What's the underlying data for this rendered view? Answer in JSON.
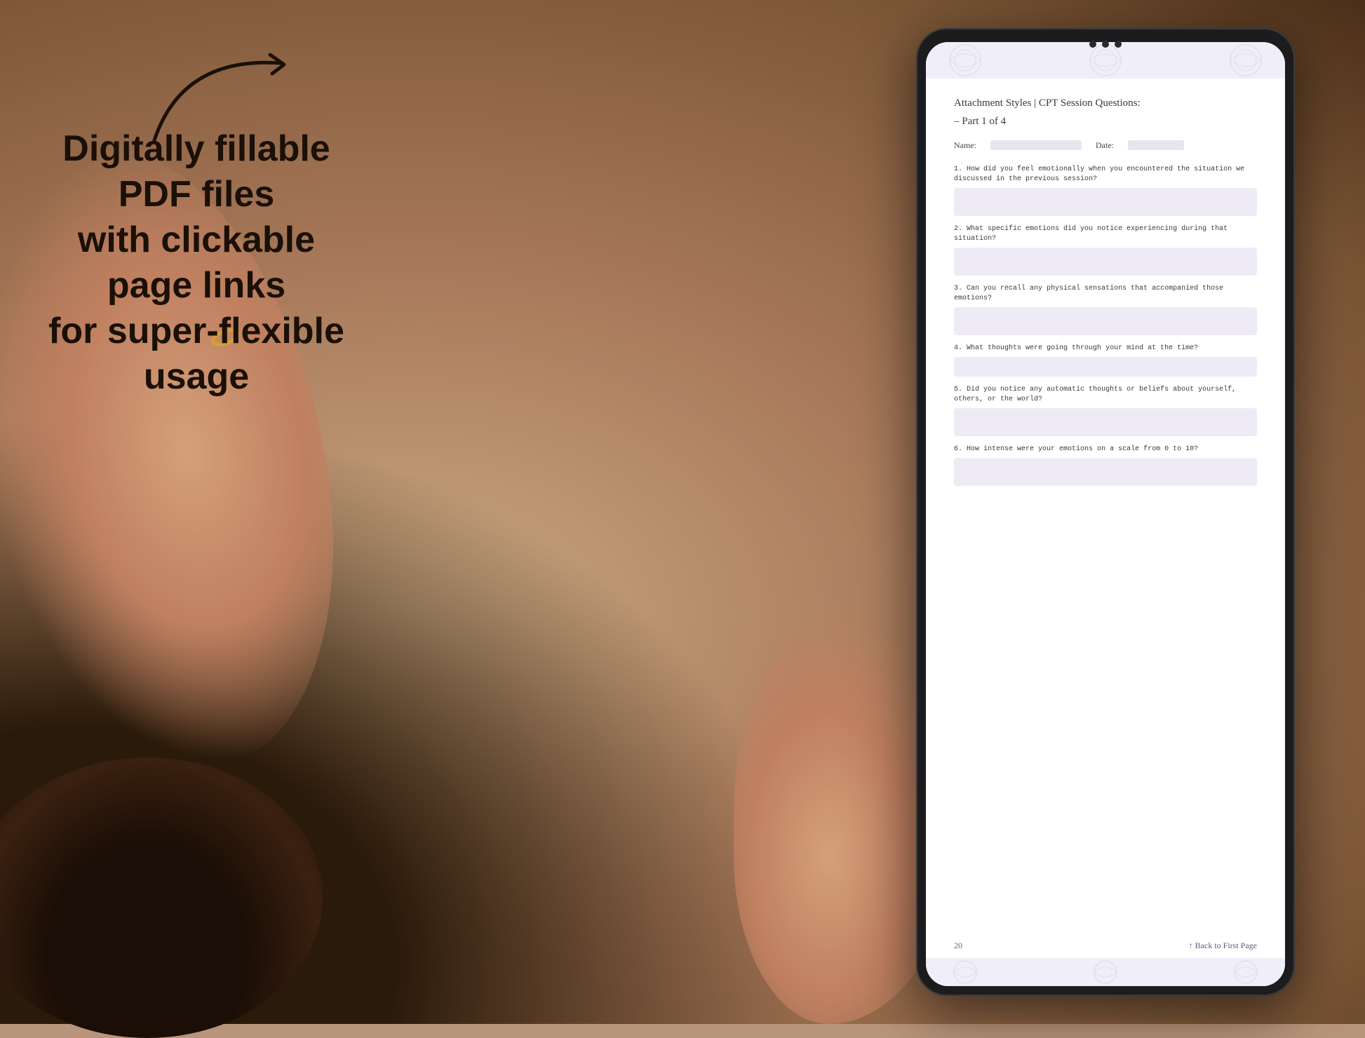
{
  "background": {
    "color": "#b8957a"
  },
  "marketing": {
    "headline_line1": "Digitally fillable PDF files",
    "headline_line2": "with clickable page links",
    "headline_line3": "for super-flexible usage",
    "arrow_label": "arrow pointing to tablet"
  },
  "tablet": {
    "screen": {
      "pdf_page": {
        "title_line1": "Attachment Styles | CPT Session Questions:",
        "title_line2": "– Part 1 of 4",
        "name_label": "Name:",
        "date_label": "Date:",
        "questions": [
          {
            "number": "1.",
            "text": "How did you feel emotionally when you encountered the situation we discussed in the previous session?"
          },
          {
            "number": "2.",
            "text": "What specific emotions did you notice experiencing during that situation?"
          },
          {
            "number": "3.",
            "text": "Can you recall any physical sensations that accompanied those emotions?"
          },
          {
            "number": "4.",
            "text": "What thoughts were going through your mind at the time?"
          },
          {
            "number": "5.",
            "text": "Did you notice any automatic thoughts or beliefs about yourself, others, or the world?"
          },
          {
            "number": "6.",
            "text": "How intense were your emotions on a scale from 0 to 10?"
          }
        ],
        "footer": {
          "page_number": "20",
          "back_link": "↑ Back to First Page"
        }
      }
    }
  }
}
